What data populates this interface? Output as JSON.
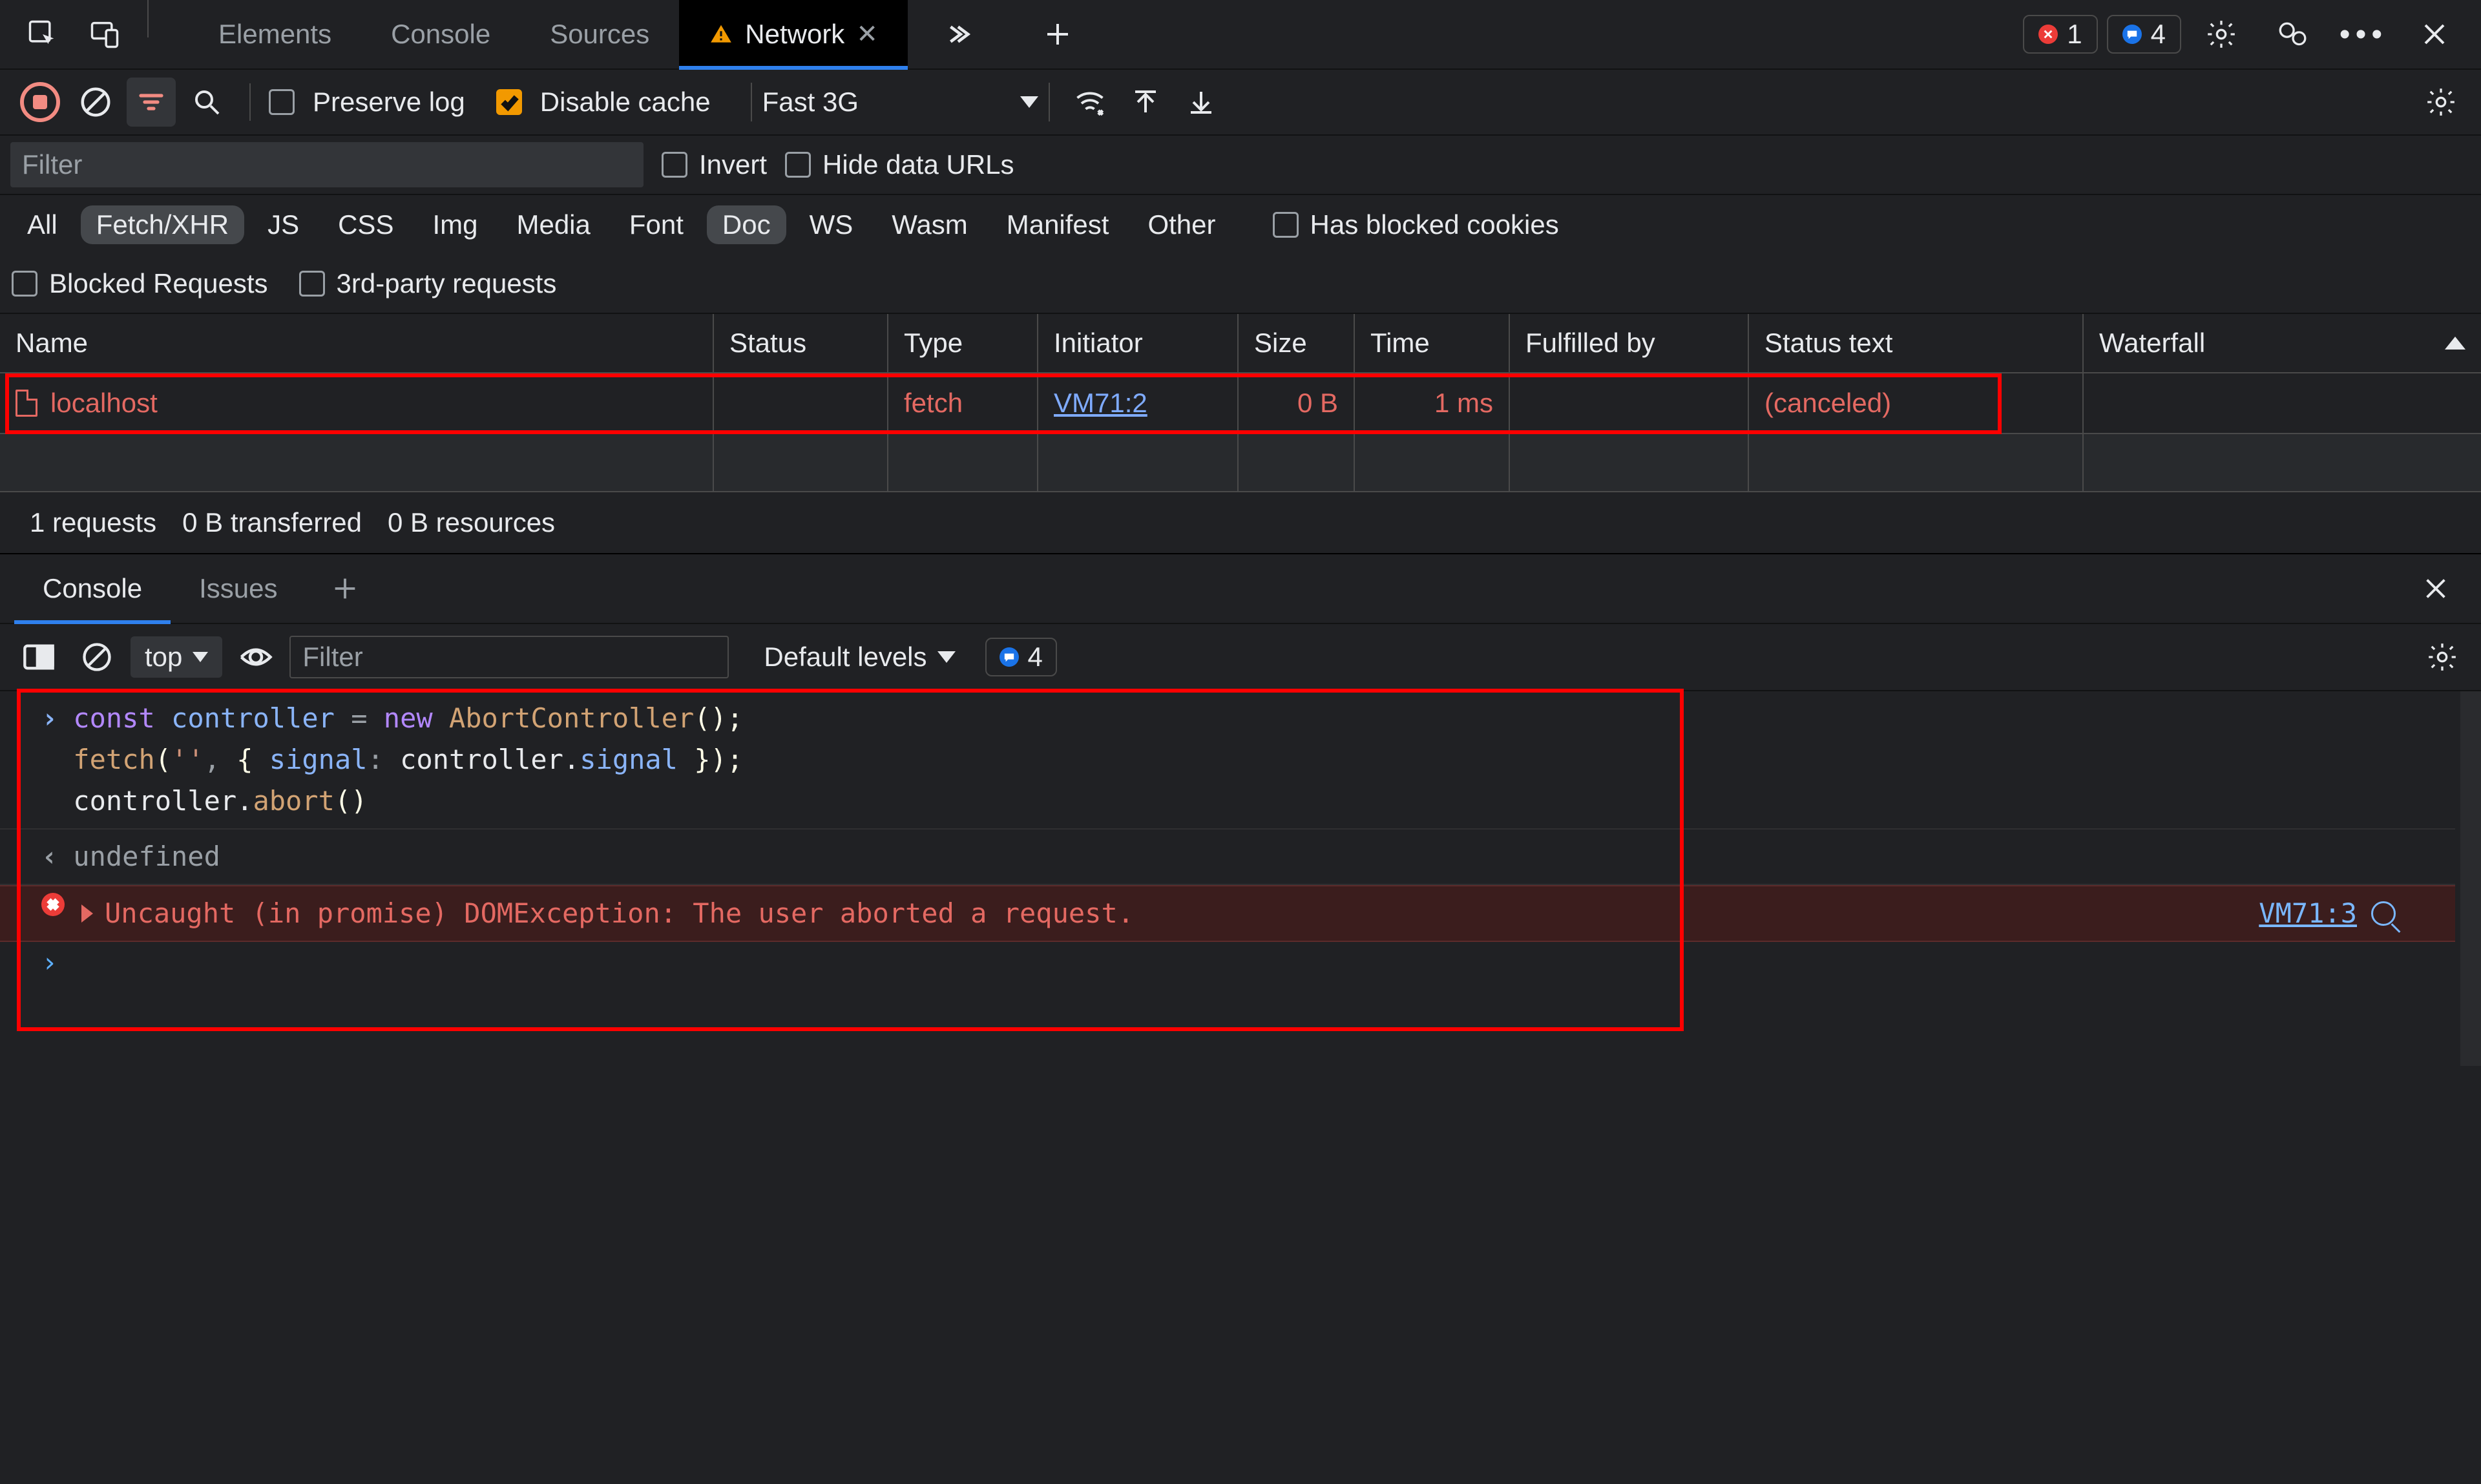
{
  "top": {
    "tabs": [
      "Elements",
      "Console",
      "Sources",
      "Network"
    ],
    "active": "Network",
    "errors": "1",
    "messages": "4"
  },
  "toolbar": {
    "preserve_log": "Preserve log",
    "disable_cache": "Disable cache",
    "throttle": "Fast 3G"
  },
  "filter": {
    "placeholder": "Filter",
    "invert": "Invert",
    "hide_data": "Hide data URLs"
  },
  "types": [
    "All",
    "Fetch/XHR",
    "JS",
    "CSS",
    "Img",
    "Media",
    "Font",
    "Doc",
    "WS",
    "Wasm",
    "Manifest",
    "Other"
  ],
  "types_extra": {
    "has_blocked": "Has blocked cookies",
    "blocked_req": "Blocked Requests",
    "third_party": "3rd-party requests"
  },
  "columns": [
    "Name",
    "Status",
    "Type",
    "Initiator",
    "Size",
    "Time",
    "Fulfilled by",
    "Status text",
    "Waterfall"
  ],
  "row": {
    "name": "localhost",
    "status": "",
    "type": "fetch",
    "initiator": "VM71:2",
    "size": "0 B",
    "time": "1 ms",
    "fulfilled": "",
    "statustext": "(canceled)"
  },
  "summary": {
    "requests": "1 requests",
    "transferred": "0 B transferred",
    "resources": "0 B resources"
  },
  "drawer": {
    "tabs": [
      "Console",
      "Issues"
    ],
    "active": "Console",
    "context": "top",
    "filter_ph": "Filter",
    "levels": "Default levels",
    "msg_count": "4"
  },
  "console": {
    "l1": "const controller = new AbortController();",
    "l2": "fetch('', { signal: controller.signal });",
    "l3": "controller.abort()",
    "ret": "undefined",
    "err": "Uncaught (in promise) DOMException: The user aborted a request.",
    "err_src": "VM71:3"
  }
}
